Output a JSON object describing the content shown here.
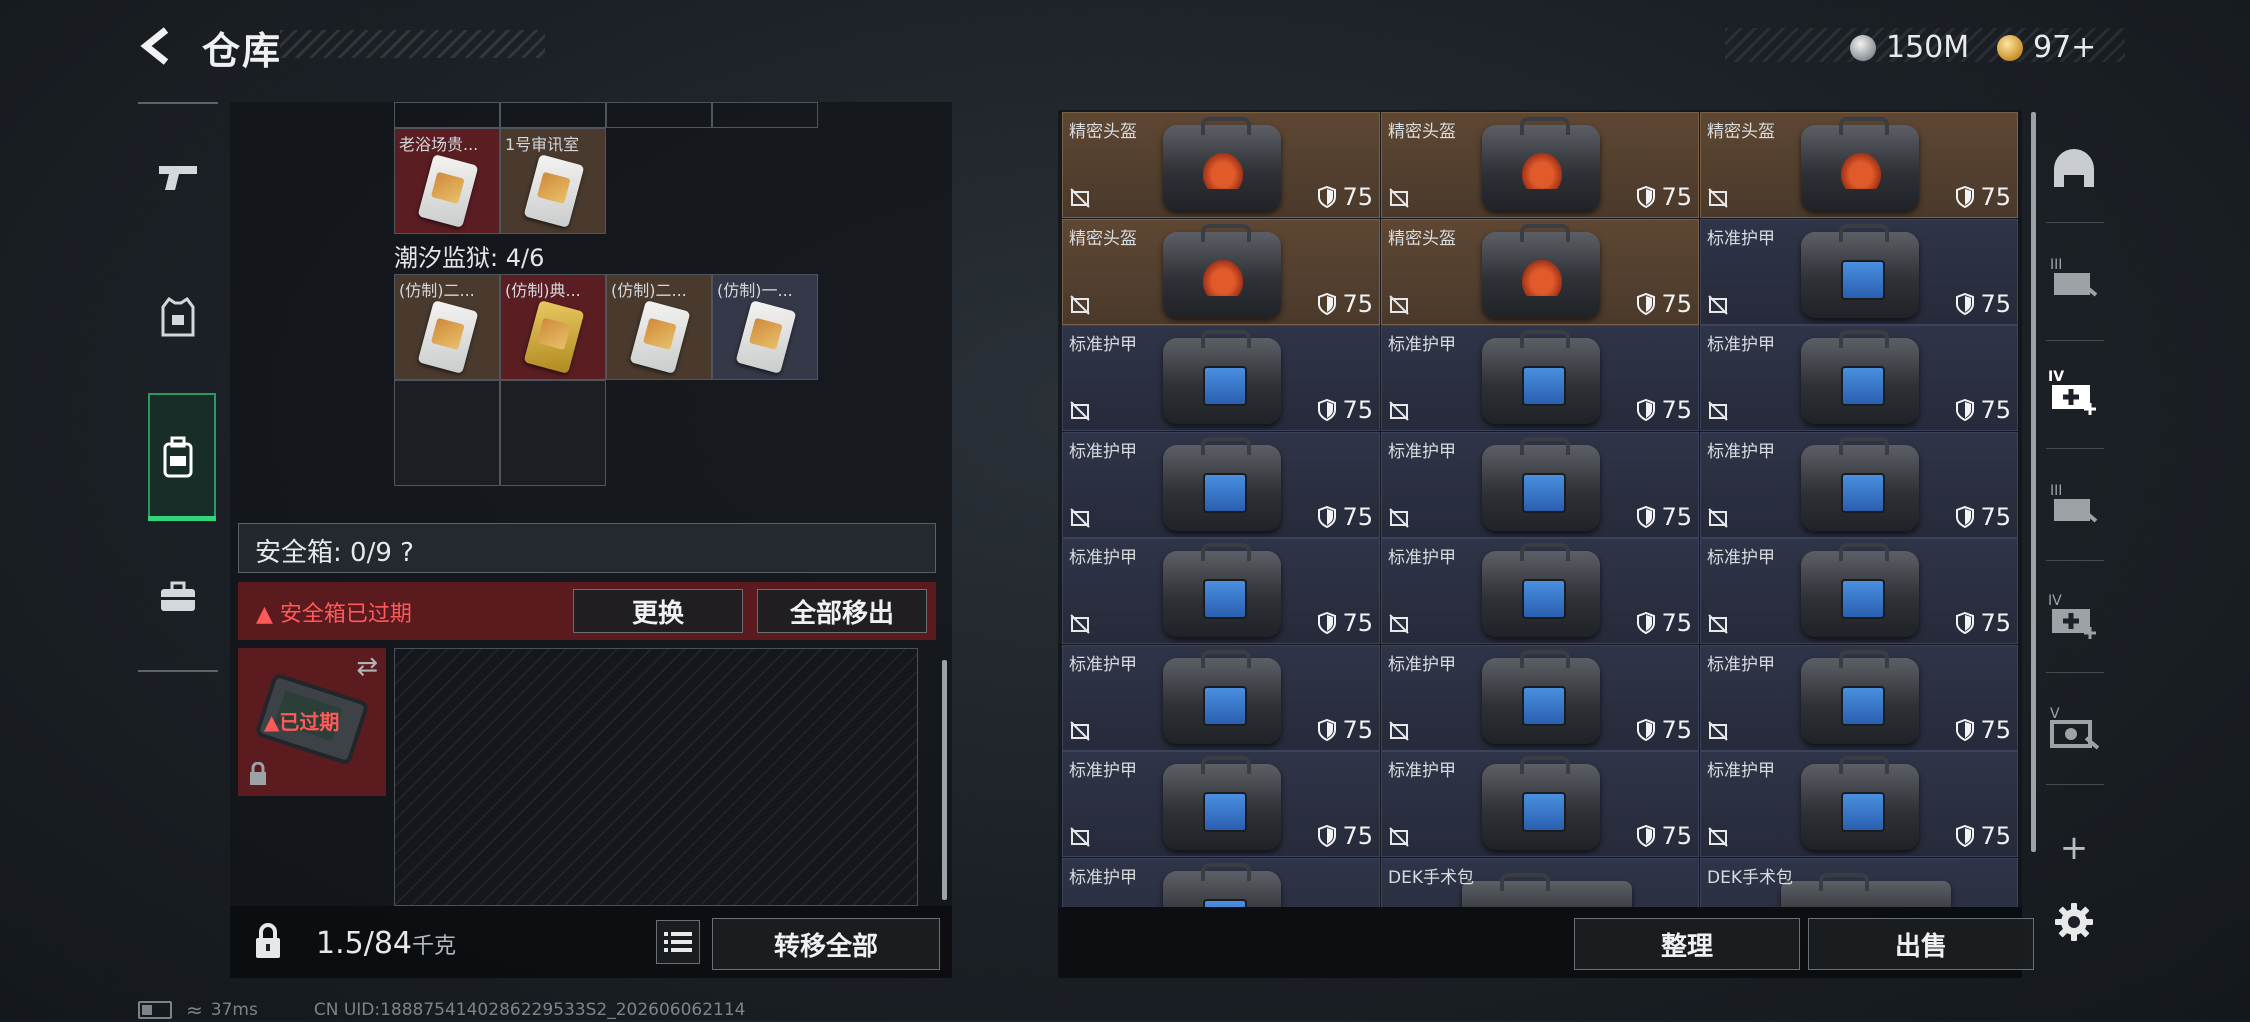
{
  "header": {
    "title": "仓库",
    "currency_silver": "150M",
    "currency_gold": "97+"
  },
  "left_panel": {
    "top_items": [
      {
        "label": "老浴场贵..."
      },
      {
        "label": "1号审讯室"
      }
    ],
    "prison_label": "潮汐监狱: 4/6",
    "prison_items": [
      {
        "label": "(仿制)二..."
      },
      {
        "label": "(仿制)典..."
      },
      {
        "label": "(仿制)二..."
      },
      {
        "label": "(仿制)一..."
      }
    ],
    "safebox_title": "安全箱: 0/9 ?",
    "expired_text": "安全箱已过期",
    "replace_button": "更换",
    "move_all_out_button": "全部移出",
    "safebox_badge": "已过期",
    "weight_value": "1.5/84",
    "weight_unit": "千克",
    "transfer_all_button": "转移全部"
  },
  "right_panel": {
    "items": [
      {
        "name": "精密头盔",
        "durability": "75",
        "kind": "helmet"
      },
      {
        "name": "精密头盔",
        "durability": "75",
        "kind": "helmet"
      },
      {
        "name": "精密头盔",
        "durability": "75",
        "kind": "helmet"
      },
      {
        "name": "精密头盔",
        "durability": "75",
        "kind": "helmet"
      },
      {
        "name": "精密头盔",
        "durability": "75",
        "kind": "helmet"
      },
      {
        "name": "标准护甲",
        "durability": "75",
        "kind": "armor"
      },
      {
        "name": "标准护甲",
        "durability": "75",
        "kind": "armor"
      },
      {
        "name": "标准护甲",
        "durability": "75",
        "kind": "armor"
      },
      {
        "name": "标准护甲",
        "durability": "75",
        "kind": "armor"
      },
      {
        "name": "标准护甲",
        "durability": "75",
        "kind": "armor"
      },
      {
        "name": "标准护甲",
        "durability": "75",
        "kind": "armor"
      },
      {
        "name": "标准护甲",
        "durability": "75",
        "kind": "armor"
      },
      {
        "name": "标准护甲",
        "durability": "75",
        "kind": "armor"
      },
      {
        "name": "标准护甲",
        "durability": "75",
        "kind": "armor"
      },
      {
        "name": "标准护甲",
        "durability": "75",
        "kind": "armor"
      },
      {
        "name": "标准护甲",
        "durability": "75",
        "kind": "armor"
      },
      {
        "name": "标准护甲",
        "durability": "75",
        "kind": "armor"
      },
      {
        "name": "标准护甲",
        "durability": "75",
        "kind": "armor"
      },
      {
        "name": "标准护甲",
        "durability": "75",
        "kind": "armor"
      },
      {
        "name": "标准护甲",
        "durability": "75",
        "kind": "armor"
      },
      {
        "name": "标准护甲",
        "durability": "75",
        "kind": "armor"
      },
      {
        "name": "标准护甲",
        "durability": "",
        "kind": "armor"
      },
      {
        "name": "DEK手术包",
        "durability": "",
        "kind": "pack"
      },
      {
        "name": "DEK手术包",
        "durability": "",
        "kind": "pack"
      }
    ],
    "sort_button": "整理",
    "sell_button": "出售"
  },
  "status_bar": {
    "ping": "37ms",
    "uid": "CN UID:1888754140286229533S2_202606062114"
  },
  "colors": {
    "accent_green": "#2fd47d",
    "expired_red": "#ff5a5a",
    "helmet_bg": "#5e4733",
    "armor_bg": "#2f3448"
  }
}
